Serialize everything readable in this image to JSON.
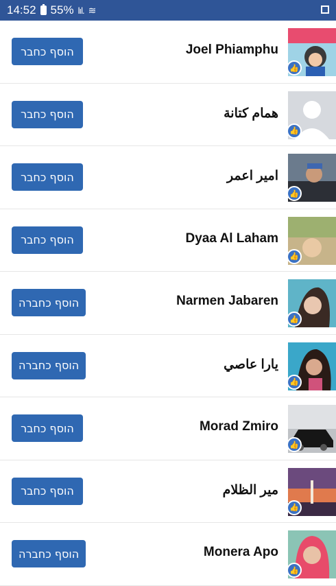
{
  "status_bar": {
    "time": "14:52",
    "battery": "55%"
  },
  "friends": [
    {
      "name": "Joel Phiamphu",
      "button": "הוסף כחבר",
      "avatar": "photo-child"
    },
    {
      "name": "همام كتانة",
      "button": "הוסף כחבר",
      "avatar": "default-silhouette"
    },
    {
      "name": "امير اعمر",
      "button": "הוסף כחבר",
      "avatar": "photo-man"
    },
    {
      "name": "Dyaa Al Laham",
      "button": "הוסף כחבר",
      "avatar": "photo-outdoor"
    },
    {
      "name": "Narmen Jabaren",
      "button": "הוסף כחברה",
      "avatar": "photo-woman"
    },
    {
      "name": "يارا عاصي",
      "button": "הוסף כחברה",
      "avatar": "photo-woman-2"
    },
    {
      "name": "Morad Zmiro",
      "button": "הוסף כחבר",
      "avatar": "photo-car"
    },
    {
      "name": "مير الظلام",
      "button": "הוסף כחבר",
      "avatar": "photo-sunset"
    },
    {
      "name": "Monera Apo",
      "button": "הוסף כחברה",
      "avatar": "photo-woman-hijab"
    }
  ]
}
